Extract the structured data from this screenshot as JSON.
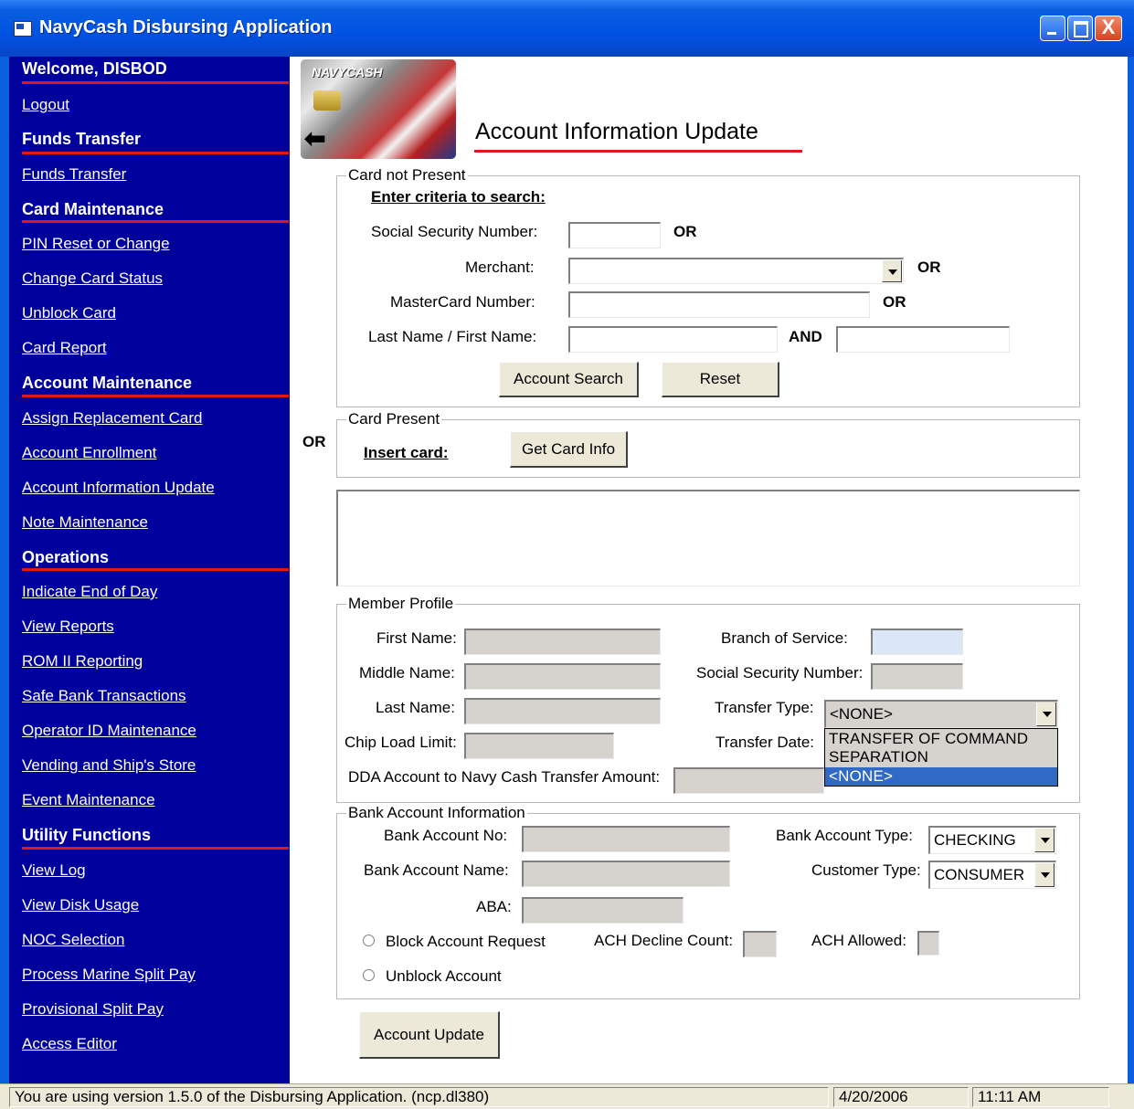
{
  "window": {
    "title": "NavyCash Disbursing Application",
    "close_glyph": "X"
  },
  "sidebar": {
    "welcome": "Welcome, DISBOD",
    "logout": "Logout",
    "sections": [
      {
        "title": "Funds Transfer",
        "items": [
          "Funds Transfer"
        ]
      },
      {
        "title": "Card Maintenance",
        "items": [
          "PIN Reset or Change",
          "Change Card Status",
          "Unblock Card",
          "Card Report"
        ]
      },
      {
        "title": "Account Maintenance",
        "items": [
          "Assign Replacement Card",
          "Account Enrollment",
          "Account Information Update",
          "Note Maintenance"
        ]
      },
      {
        "title": "Operations",
        "items": [
          "Indicate End of Day",
          "View Reports",
          "ROM II Reporting",
          "Safe Bank Transactions",
          "Operator ID Maintenance",
          "Vending and Ship's Store",
          "Event Maintenance"
        ]
      },
      {
        "title": "Utility Functions",
        "items": [
          "View Log",
          "View Disk Usage",
          "NOC Selection",
          "Process Marine Split Pay",
          "Provisional Split Pay",
          "Access Editor"
        ]
      }
    ]
  },
  "logo": {
    "text": "NAVYCASH",
    "arrow": "⬅"
  },
  "page_title": "Account Information Update",
  "card_not_present": {
    "legend": "Card not Present",
    "criteria": "Enter criteria to search:",
    "ssn_label": "Social Security Number:",
    "merchant_label": "Merchant:",
    "mastercard_label": "MasterCard  Number:",
    "name_label": "Last Name / First Name:",
    "or": "OR",
    "and": "AND",
    "search_button": "Account Search",
    "reset_button": "Reset"
  },
  "or_label": "OR",
  "card_present": {
    "legend": "Card Present",
    "insert": "Insert card:",
    "button": "Get Card Info"
  },
  "member_profile": {
    "legend": "Member Profile",
    "first_name": "First Name:",
    "middle_name": "Middle Name:",
    "last_name": "Last Name:",
    "chip_load": "Chip Load Limit:",
    "dda_transfer": "DDA Account to Navy Cash Transfer Amount:",
    "branch": "Branch of Service:",
    "ssn": "Social Security Number:",
    "transfer_type": "Transfer Type:",
    "transfer_type_value": "<NONE>",
    "transfer_date": "Transfer Date:",
    "transfer_type_options": [
      "TRANSFER OF COMMAND",
      "SEPARATION",
      "<NONE>"
    ]
  },
  "bank_account": {
    "legend": "Bank Account Information",
    "account_no": "Bank Account No:",
    "account_name": "Bank Account Name:",
    "aba": "ABA:",
    "account_type": "Bank Account Type:",
    "account_type_value": "CHECKING",
    "customer_type": "Customer Type:",
    "customer_type_value": "CONSUMER",
    "block_request": "Block Account Request",
    "unblock": "Unblock Account",
    "ach_decline": "ACH Decline Count:",
    "ach_allowed": "ACH Allowed:"
  },
  "update_button": "Account Update",
  "status": {
    "message": "You are using version 1.5.0  of the Disbursing Application. (ncp.dl380)",
    "date": "4/20/2006",
    "time": "11:11 AM"
  }
}
